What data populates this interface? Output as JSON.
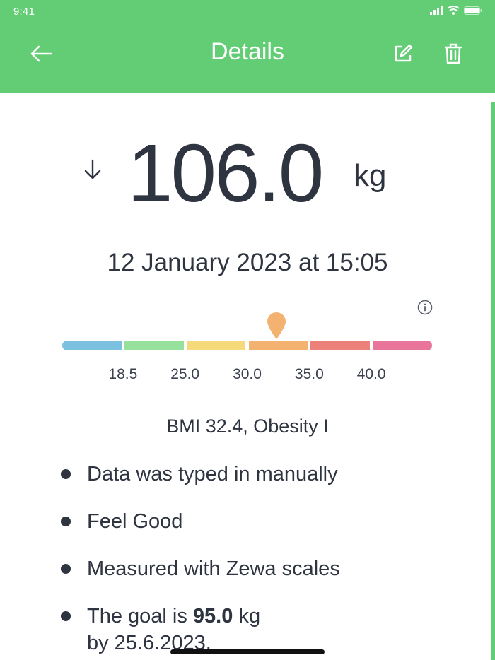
{
  "status_bar": {
    "time": "9:41"
  },
  "nav": {
    "title": "Details",
    "back_icon": "arrow-left-icon",
    "edit_icon": "edit-icon",
    "delete_icon": "trash-icon"
  },
  "measurement": {
    "trend_icon": "arrow-down-icon",
    "weight": "106.0",
    "unit": "kg",
    "datetime": "12 January 2023 at 15:05"
  },
  "bmi_scale": {
    "ticks": [
      "18.5",
      "25.0",
      "30.0",
      "35.0",
      "40.0"
    ],
    "segment_colors": [
      "#7cc2e0",
      "#96e29c",
      "#f5d97a",
      "#f3b26f",
      "#ec8179",
      "#e9769a"
    ],
    "marker_color": "#f3b26f",
    "current_bmi": 32.4,
    "label": "BMI 32.4, Obesity I",
    "info_icon": "info-icon"
  },
  "notes": [
    {
      "text": "Data was typed in manually"
    },
    {
      "text": "Feel Good"
    },
    {
      "text": "Measured with Zewa scales"
    },
    {
      "prefix": "The goal is",
      "goal_value": "95.0",
      "goal_unit": "kg",
      "line2": "by 25.6.2023."
    }
  ],
  "colors": {
    "accent": "#62cd74",
    "text": "#2f3441"
  }
}
